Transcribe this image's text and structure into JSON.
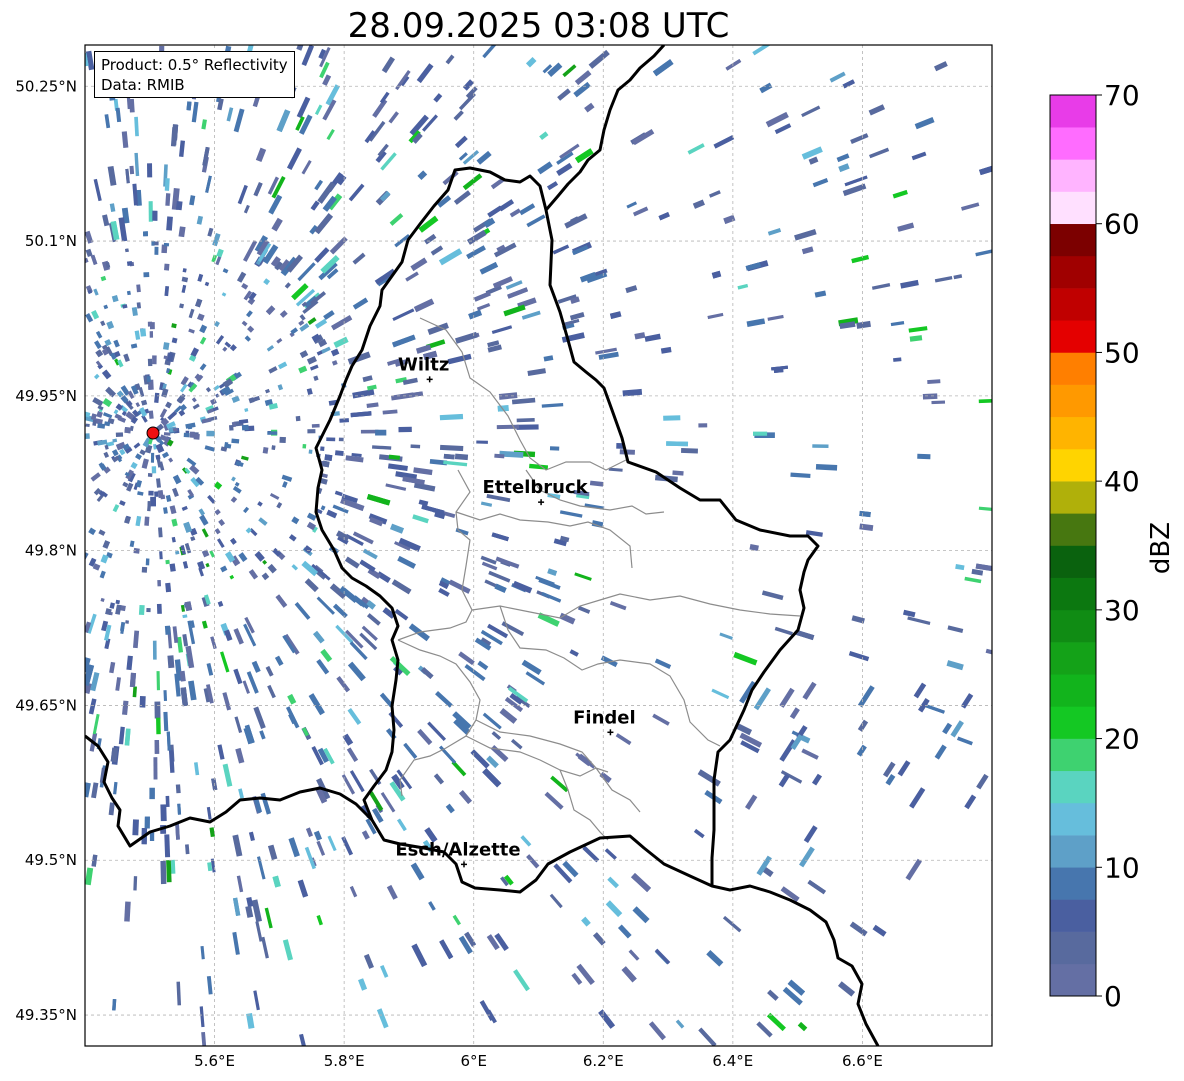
{
  "title": "28.09.2025 03:08 UTC",
  "info": {
    "product": "Product: 0.5° Reflectivity",
    "data": "Data: RMIB"
  },
  "map": {
    "lon_range": [
      5.4,
      6.8
    ],
    "lat_range": [
      49.32,
      50.29
    ],
    "radar_site": {
      "lon": 5.505,
      "lat": 49.914
    },
    "lon_ticks": [
      {
        "value": 5.6,
        "label": "5.6°E"
      },
      {
        "value": 5.8,
        "label": "5.8°E"
      },
      {
        "value": 6.0,
        "label": "6°E"
      },
      {
        "value": 6.2,
        "label": "6.2°E"
      },
      {
        "value": 6.4,
        "label": "6.4°E"
      },
      {
        "value": 6.6,
        "label": "6.6°E"
      }
    ],
    "lat_ticks": [
      {
        "value": 50.25,
        "label": "50.25°N"
      },
      {
        "value": 50.1,
        "label": "50.1°N"
      },
      {
        "value": 49.95,
        "label": "49.95°N"
      },
      {
        "value": 49.8,
        "label": "49.8°N"
      },
      {
        "value": 49.65,
        "label": "49.65°N"
      },
      {
        "value": 49.5,
        "label": "49.5°N"
      },
      {
        "value": 49.35,
        "label": "49.35°N"
      }
    ],
    "cities": [
      {
        "name": "Wiltz",
        "lon": 5.932,
        "lat": 49.966
      },
      {
        "name": "Ettelbruck",
        "lon": 6.104,
        "lat": 49.847
      },
      {
        "name": "Findel",
        "lon": 6.211,
        "lat": 49.624
      },
      {
        "name": "Esch/Alzette",
        "lon": 5.985,
        "lat": 49.496
      }
    ]
  },
  "colorbar": {
    "label": "dBZ",
    "min": 0,
    "max": 70,
    "tick_labels": [
      "0",
      "10",
      "20",
      "30",
      "40",
      "50",
      "60",
      "70"
    ],
    "colors": [
      "#646fa4",
      "#586a9e",
      "#4a5fa0",
      "#4776ae",
      "#5ea0c8",
      "#66bedc",
      "#5ad4c0",
      "#3ed270",
      "#14c823",
      "#12b41c",
      "#14a218",
      "#108c14",
      "#0c7810",
      "#0a620e",
      "#477710",
      "#b0b00a",
      "#ffd400",
      "#ffb400",
      "#ff9900",
      "#ff7f00",
      "#e40000",
      "#c00000",
      "#a00000",
      "#7c0000",
      "#ffe0ff",
      "#ffb4ff",
      "#ff6cff",
      "#e83ce8"
    ]
  }
}
